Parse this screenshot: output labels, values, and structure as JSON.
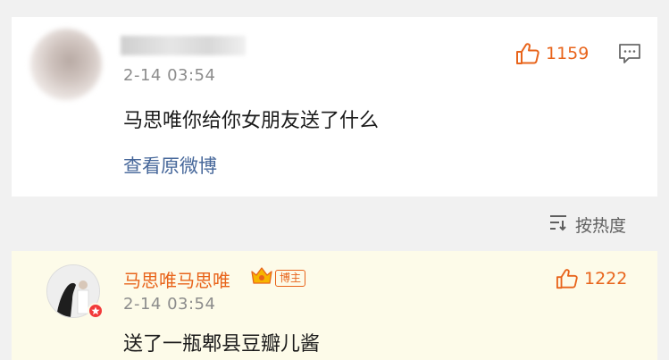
{
  "top_comment": {
    "time": "2-14 03:54",
    "text": "马思唯你给你女朋友送了什么",
    "like_count": "1159",
    "view_original": "查看原微博"
  },
  "sort": {
    "label": "按热度"
  },
  "reply": {
    "name": "马思唯马思唯",
    "badge": "博主",
    "time": "2-14 03:54",
    "text": "送了一瓶郫县豆瓣儿酱",
    "like_count": "1222"
  },
  "colors": {
    "accent_orange": "#e8641b",
    "link_blue": "#46679a",
    "verified_red": "#f23a3a"
  },
  "icons": [
    "thumbs-up-icon",
    "comment-bubble-icon",
    "sort-icon",
    "crown-icon",
    "verified-badge-icon"
  ]
}
